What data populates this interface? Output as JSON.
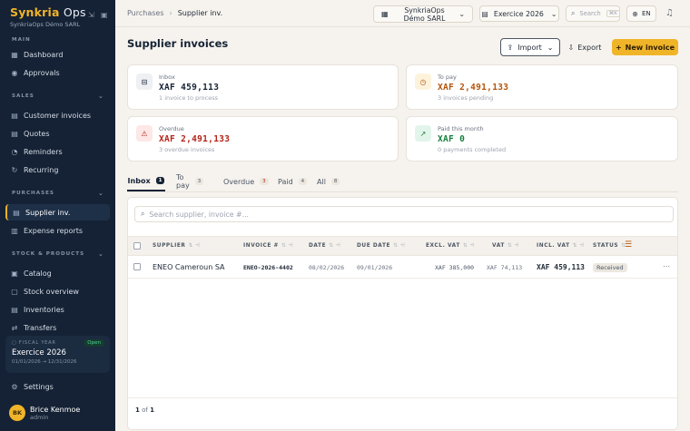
{
  "brand": {
    "name_a": "Synkria",
    "name_b": " Ops",
    "org": "SynkriaOps Démo SARL"
  },
  "sidebar": {
    "sections": {
      "main": "MAIN",
      "sales": "SALES",
      "purchases": "PURCHASES",
      "stock": "STOCK & PRODUCTS"
    },
    "items": {
      "dashboard": "Dashboard",
      "approvals": "Approvals",
      "customer_invoices": "Customer invoices",
      "quotes": "Quotes",
      "reminders": "Reminders",
      "recurring": "Recurring",
      "supplier_inv": "Supplier inv.",
      "expense_reports": "Expense reports",
      "catalog": "Catalog",
      "stock_overview": "Stock overview",
      "inventories": "Inventories",
      "transfers": "Transfers",
      "settings": "Settings"
    },
    "fiscal": {
      "label": "FISCAL YEAR",
      "status": "Open",
      "name": "Exercice 2026",
      "range": "01/01/2026 → 12/31/2026"
    },
    "user": {
      "initials": "BK",
      "name": "Brice Kenmoe",
      "role": "admin"
    }
  },
  "topbar": {
    "breadcrumb": [
      "Purchases",
      "Supplier inv."
    ],
    "company": "SynkriaOps Démo SARL",
    "fiscal": "Exercice 2026",
    "search_placeholder": "Search",
    "search_kbd": "⌘K",
    "lang": "EN"
  },
  "page": {
    "title": "Supplier invoices",
    "import": "Import",
    "export": "Export",
    "new": "New invoice"
  },
  "cards": [
    {
      "label": "Inbox",
      "value": "XAF 459,113",
      "sub": "1 invoice to process",
      "color": "#152235"
    },
    {
      "label": "To pay",
      "value": "XAF 2,491,133",
      "sub": "3 invoices pending",
      "color": "#b45309"
    },
    {
      "label": "Overdue",
      "value": "XAF 2,491,133",
      "sub": "3 overdue invoices",
      "color": "#b42318"
    },
    {
      "label": "Paid this month",
      "value": "XAF 0",
      "sub": "0 payments completed",
      "color": "#15803d"
    }
  ],
  "tabs": [
    {
      "label": "Inbox",
      "count": "1"
    },
    {
      "label": "To pay",
      "count": "3"
    },
    {
      "label": "Overdue",
      "count": "3"
    },
    {
      "label": "Paid",
      "count": "4"
    },
    {
      "label": "All",
      "count": "8"
    }
  ],
  "table": {
    "search_placeholder": "Search supplier, invoice #...",
    "headers": {
      "supplier": "SUPPLIER",
      "invoice": "INVOICE #",
      "date": "DATE",
      "due": "DUE DATE",
      "excl": "EXCL. VAT",
      "vat": "VAT",
      "incl": "INCL. VAT",
      "status": "STATUS"
    },
    "rows": [
      {
        "supplier": "ENEO Cameroun SA",
        "invoice": "ENEO-2026-4402",
        "date": "08/02/2026",
        "due": "09/01/2026",
        "excl": "XAF 385,000",
        "vat": "XAF 74,113",
        "incl": "XAF 459,113",
        "status": "Received"
      }
    ],
    "pager": {
      "current": "1",
      "of": "of",
      "total": "1"
    }
  }
}
